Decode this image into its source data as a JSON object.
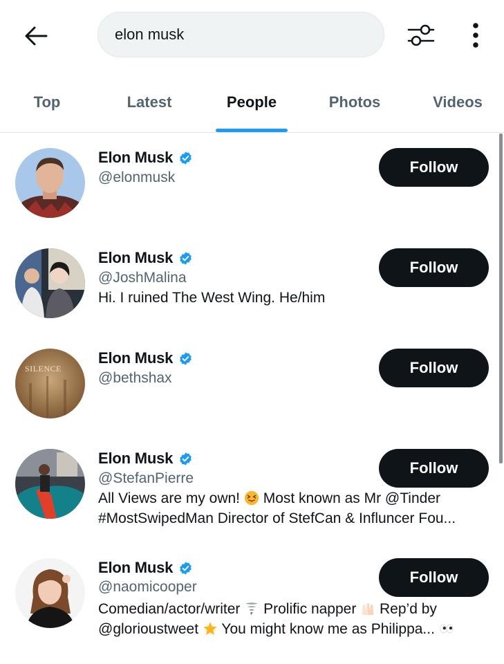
{
  "search": {
    "value": "elon musk",
    "back_icon": "arrow-left-icon",
    "filter_icon": "sliders-icon",
    "more_icon": "vertical-ellipsis-icon"
  },
  "tabs": [
    {
      "label": "Top"
    },
    {
      "label": "Latest"
    },
    {
      "label": "People",
      "active": true
    },
    {
      "label": "Photos"
    },
    {
      "label": "Videos"
    }
  ],
  "colors": {
    "accent": "#1d9bf0",
    "text": "#0f1419",
    "muted": "#536471",
    "button": "#0f1419"
  },
  "users": [
    {
      "name": "Elon Musk",
      "handle": "@elonmusk",
      "bio": "",
      "follow_label": "Follow",
      "verified": true
    },
    {
      "name": "Elon Musk",
      "handle": "@JoshMalina",
      "bio": "Hi. I ruined The West Wing. He/him",
      "follow_label": "Follow",
      "verified": true
    },
    {
      "name": "Elon Musk",
      "handle": "@bethshax",
      "bio": "",
      "follow_label": "Follow",
      "verified": true,
      "avatar_text": "SILENCE"
    },
    {
      "name": "Elon Musk",
      "handle": "@StefanPierre",
      "bio_line1_a": "All Views are my own!",
      "bio_line1_b": "Most known as Mr @Tinder",
      "bio_line2": "#MostSwipedMan Director of StefCan & Influncer Fou...",
      "follow_label": "Follow",
      "verified": true
    },
    {
      "name": "Elon Musk",
      "handle": "@naomicooper",
      "bio_line1_a": "Comedian/actor/writer",
      "bio_line1_b": "Prolific napper",
      "bio_line1_c": "Rep’d by",
      "bio_line2_a": "@glorioustweet",
      "bio_line2_b": "You might know me as Philippa...",
      "follow_label": "Follow",
      "verified": true
    }
  ]
}
